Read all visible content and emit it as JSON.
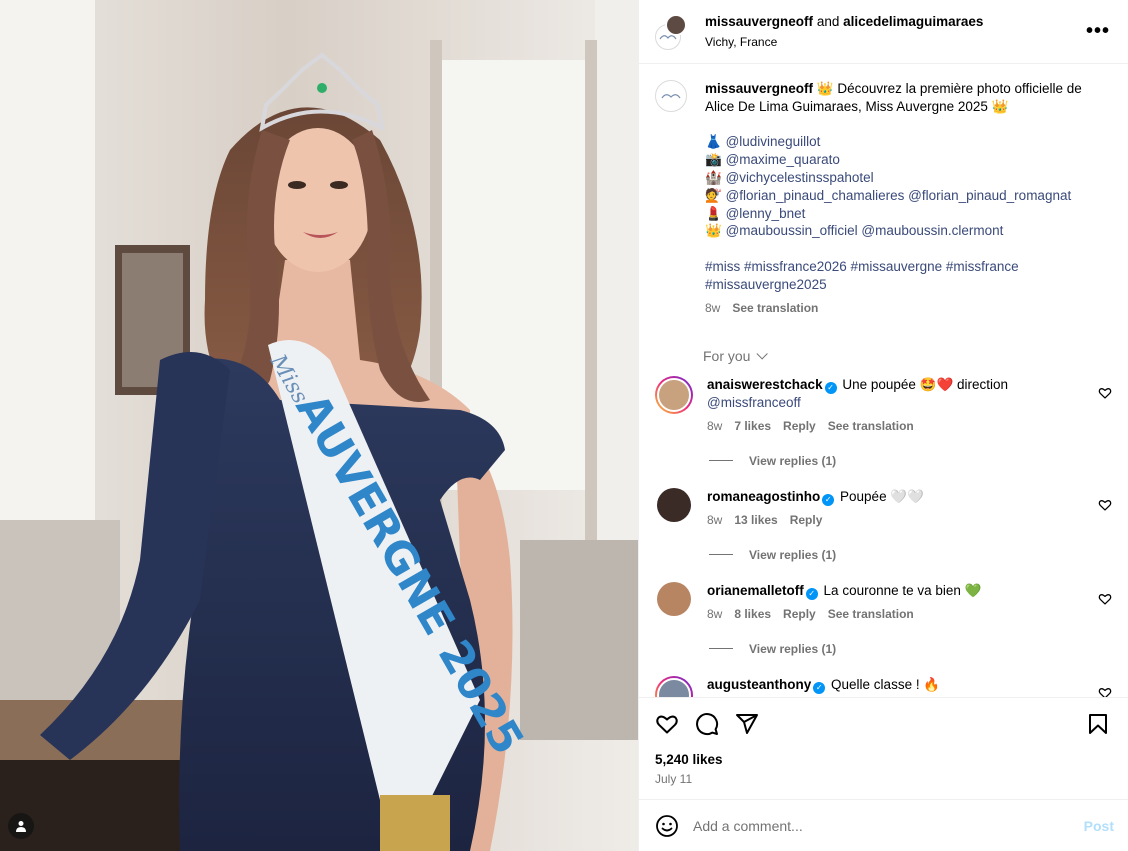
{
  "header": {
    "user1": "missauvergneoff",
    "joiner": "and",
    "user2": "alicedelimaguimaraes",
    "location": "Vichy, France",
    "more_label": "•••"
  },
  "photo": {
    "sash_top": "Miss",
    "sash_main": "AUVERGNE 2025"
  },
  "caption": {
    "username": "missauvergneoff",
    "line1": "👑 Découvrez la première photo officielle de Alice De Lima Guimaraes, Miss Auvergne 2025 👑",
    "credits": [
      {
        "emoji": "👗",
        "tags": [
          "@ludivineguillot"
        ]
      },
      {
        "emoji": "📸",
        "tags": [
          "@maxime_quarato"
        ]
      },
      {
        "emoji": "🏰",
        "tags": [
          "@vichycelestinsspahotel"
        ]
      },
      {
        "emoji": "💇",
        "tags": [
          "@florian_pinaud_chamalieres",
          "@florian_pinaud_romagnat"
        ]
      },
      {
        "emoji": "💄",
        "tags": [
          "@lenny_bnet"
        ]
      },
      {
        "emoji": "👑",
        "tags": [
          "@mauboussin_officiel",
          "@mauboussin.clermont"
        ]
      }
    ],
    "hashtags": "#miss #missfrance2026 #missauvergne #missfrance #missauvergne2025",
    "time": "8w",
    "see_translation": "See translation"
  },
  "for_you": "For you",
  "comments": [
    {
      "username": "anaiswerestchack",
      "text_before": "Une poupée 🤩❤️ direction ",
      "mention": "@missfranceoff",
      "time": "8w",
      "likes": "7 likes",
      "reply": "Reply",
      "see_translation": "See translation",
      "view_replies": "View replies (1)"
    },
    {
      "username": "romaneagostinho",
      "text_before": "Poupée 🤍🤍",
      "mention": "",
      "time": "8w",
      "likes": "13 likes",
      "reply": "Reply",
      "see_translation": "",
      "view_replies": "View replies (1)"
    },
    {
      "username": "orianemalletoff",
      "text_before": "La couronne te va bien 💚",
      "mention": "",
      "time": "8w",
      "likes": "8 likes",
      "reply": "Reply",
      "see_translation": "See translation",
      "view_replies": "View replies (1)"
    },
    {
      "username": "augusteanthony",
      "text_before": "Quelle classe ! 🔥",
      "mention": "",
      "time": "",
      "likes": "",
      "reply": "",
      "see_translation": "",
      "view_replies": ""
    }
  ],
  "likes_count": "5,240 likes",
  "date": "July 11",
  "comment_box": {
    "placeholder": "Add a comment...",
    "post_label": "Post"
  },
  "colors": {
    "link": "#3a4a7a",
    "secondary_text": "#737373",
    "verified": "#0095f6",
    "post_button_disabled": "#b2dffc"
  },
  "icons": [
    "emoji-icon",
    "heart-icon",
    "comment-icon",
    "share-icon",
    "bookmark-icon",
    "more-icon",
    "user-tag-icon",
    "verified-icon",
    "chevron-down-icon"
  ]
}
